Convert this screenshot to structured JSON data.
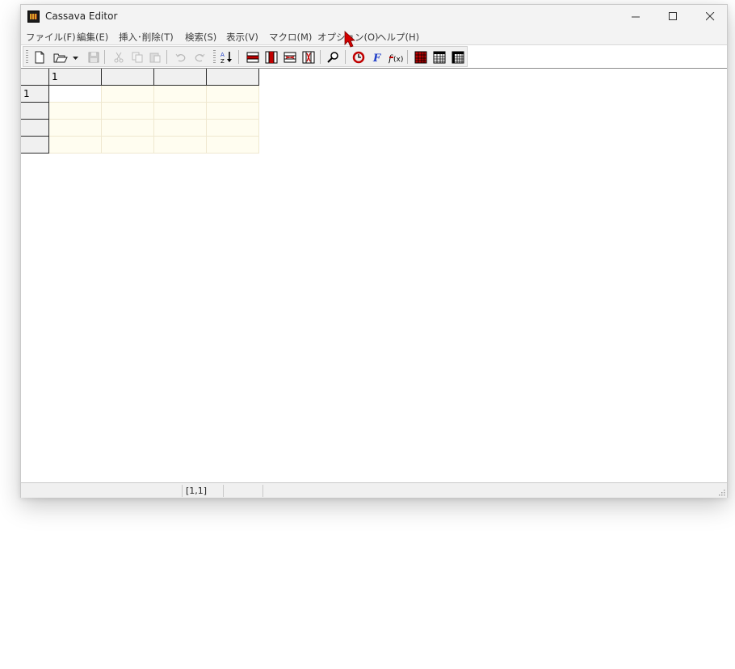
{
  "window": {
    "title": "Cassava Editor",
    "app_icon": "cassava-app-icon"
  },
  "menu": {
    "items": [
      {
        "label": "ファイル(F)"
      },
      {
        "label": "編集(E)"
      },
      {
        "label": "挿入･削除(T)"
      },
      {
        "label": "検索(S)"
      },
      {
        "label": "表示(V)"
      },
      {
        "label": "マクロ(M)"
      },
      {
        "label": "オプション(O)"
      },
      {
        "label": "ヘルプ(H)"
      }
    ]
  },
  "toolbar": {
    "buttons": [
      "new-file-icon",
      "open-folder-icon",
      "dropdown-arrow-icon",
      "save-icon",
      "cut-icon",
      "copy-icon",
      "paste-icon",
      "undo-icon",
      "redo-icon",
      "sort-icon",
      "insert-row-icon",
      "insert-column-icon",
      "delete-row-icon",
      "delete-column-icon",
      "find-icon",
      "refresh-icon",
      "function-icon",
      "formula-icon",
      "grid-view-1-icon",
      "grid-view-2-icon",
      "grid-view-3-icon"
    ]
  },
  "sheet": {
    "column_headers": [
      "1",
      "",
      "",
      ""
    ],
    "row_headers": [
      "1",
      "",
      "",
      ""
    ],
    "active_cell": [
      1,
      1
    ]
  },
  "status": {
    "panel1": "",
    "position": "[1,1]",
    "panel3": ""
  },
  "colors": {
    "cell_background": "#fffdf0",
    "active_cell": "#ffffff",
    "toolbar_red": "#c00000",
    "toolbar_blue": "#1f3ec8",
    "cursor_red": "#d40000"
  }
}
